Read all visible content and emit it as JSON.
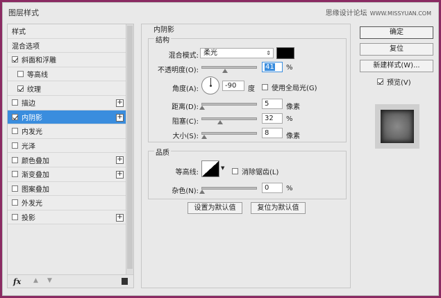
{
  "window": {
    "title": "图层样式",
    "watermark_cn": "思缘设计论坛",
    "watermark_en": "WWW.MISSYUAN.COM"
  },
  "left_list": {
    "items": [
      {
        "label": "样式",
        "checkbox": false,
        "checked": false,
        "plus": false,
        "indent": false,
        "selected": false
      },
      {
        "label": "混合选项",
        "checkbox": false,
        "checked": false,
        "plus": false,
        "indent": false,
        "selected": false
      },
      {
        "label": "斜面和浮雕",
        "checkbox": true,
        "checked": true,
        "plus": false,
        "indent": false,
        "selected": false
      },
      {
        "label": "等高线",
        "checkbox": true,
        "checked": false,
        "plus": false,
        "indent": true,
        "selected": false
      },
      {
        "label": "纹理",
        "checkbox": true,
        "checked": true,
        "plus": false,
        "indent": true,
        "selected": false
      },
      {
        "label": "描边",
        "checkbox": true,
        "checked": false,
        "plus": true,
        "indent": false,
        "selected": false
      },
      {
        "label": "内阴影",
        "checkbox": true,
        "checked": true,
        "plus": true,
        "indent": false,
        "selected": true
      },
      {
        "label": "内发光",
        "checkbox": true,
        "checked": false,
        "plus": false,
        "indent": false,
        "selected": false
      },
      {
        "label": "光泽",
        "checkbox": true,
        "checked": false,
        "plus": false,
        "indent": false,
        "selected": false
      },
      {
        "label": "颜色叠加",
        "checkbox": true,
        "checked": false,
        "plus": true,
        "indent": false,
        "selected": false
      },
      {
        "label": "渐变叠加",
        "checkbox": true,
        "checked": false,
        "plus": true,
        "indent": false,
        "selected": false
      },
      {
        "label": "图案叠加",
        "checkbox": true,
        "checked": false,
        "plus": false,
        "indent": false,
        "selected": false
      },
      {
        "label": "外发光",
        "checkbox": true,
        "checked": false,
        "plus": false,
        "indent": false,
        "selected": false
      },
      {
        "label": "投影",
        "checkbox": true,
        "checked": false,
        "plus": true,
        "indent": false,
        "selected": false
      }
    ],
    "footer_fx": "fx"
  },
  "inner_shadow": {
    "title": "内阴影",
    "structure": {
      "label": "结构",
      "blend_mode_label": "混合模式:",
      "blend_mode_value": "柔光",
      "color": "#000000",
      "opacity_label": "不透明度(O):",
      "opacity_value": "41",
      "opacity_level": 41,
      "opacity_unit": "%",
      "angle_label": "角度(A):",
      "angle_value": "-90",
      "angle_unit": "度",
      "global_light_label": "使用全局光(G)",
      "global_light_checked": false,
      "distance_label": "距离(D):",
      "distance_value": "5",
      "distance_unit": "像素",
      "choke_label": "阻塞(C):",
      "choke_value": "32",
      "choke_unit": "%",
      "size_label": "大小(S):",
      "size_value": "8",
      "size_unit": "像素"
    },
    "quality": {
      "label": "品质",
      "contour_label": "等高线:",
      "anti_alias_label": "消除锯齿(L)",
      "anti_alias_checked": false,
      "noise_label": "杂色(N):",
      "noise_value": "0",
      "noise_unit": "%"
    },
    "set_default_label": "设置为默认值",
    "reset_default_label": "复位为默认值"
  },
  "right": {
    "ok_label": "确定",
    "reset_label": "复位",
    "new_style_label": "新建样式(W)...",
    "preview_label": "预览(V)",
    "preview_checked": true
  }
}
